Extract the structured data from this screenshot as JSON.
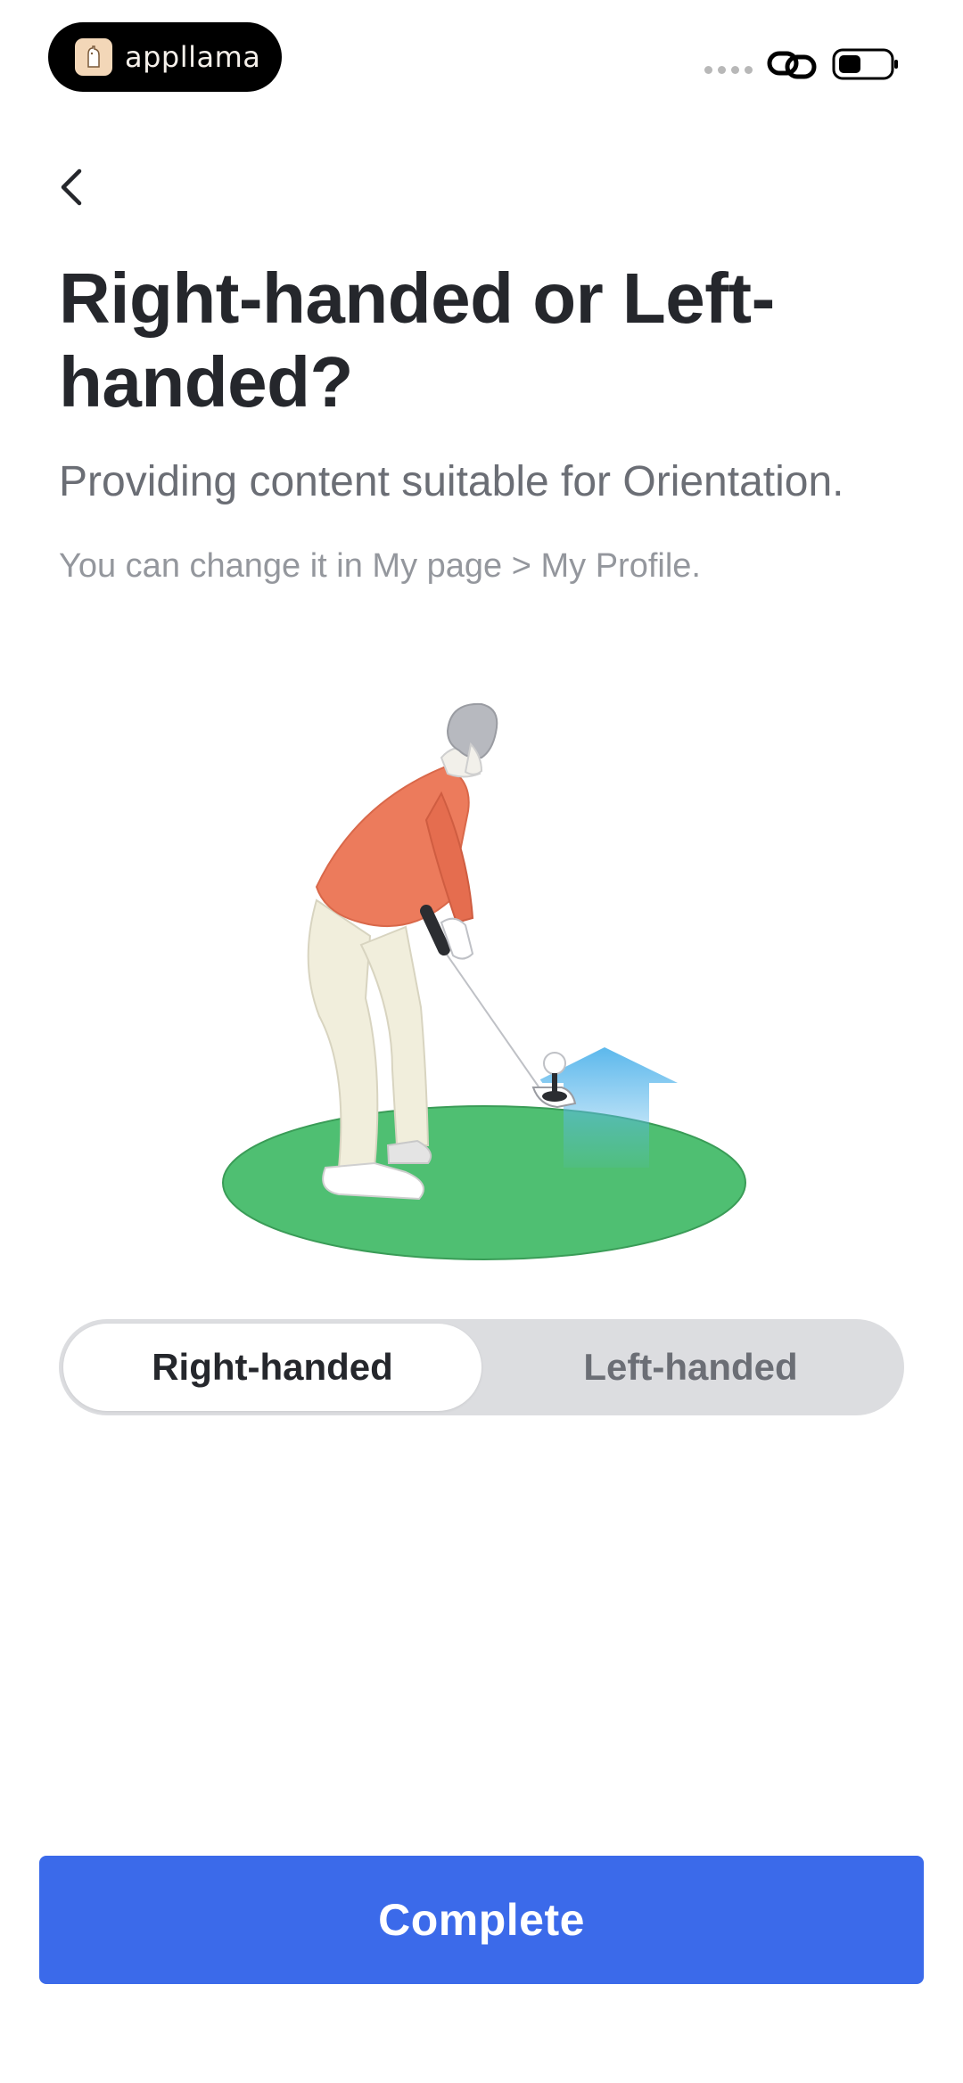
{
  "status_bar": {
    "app_name": "appllama",
    "logo_icon": "llama-icon",
    "link_icon": "link-icon",
    "battery_icon": "battery-icon"
  },
  "header": {
    "back_icon": "chevron-left-icon"
  },
  "content": {
    "title": "Right-handed or Left-handed?",
    "subtitle": "Providing content suitable for Orientation.",
    "hint": "You can change it in My page > My Profile."
  },
  "orientation_toggle": {
    "options": [
      {
        "label": "Right-handed",
        "selected": true
      },
      {
        "label": "Left-handed",
        "selected": false
      }
    ]
  },
  "footer": {
    "complete_label": "Complete",
    "complete_color": "#3b6aea"
  },
  "colors": {
    "title": "#25272c",
    "subtitle": "#6b6e75",
    "hint": "#94979d",
    "toggle_bg": "#dcdde0",
    "turf": "#4fbf72",
    "shirt": "#ec7b5c",
    "arrow": "#5cb8ec"
  }
}
